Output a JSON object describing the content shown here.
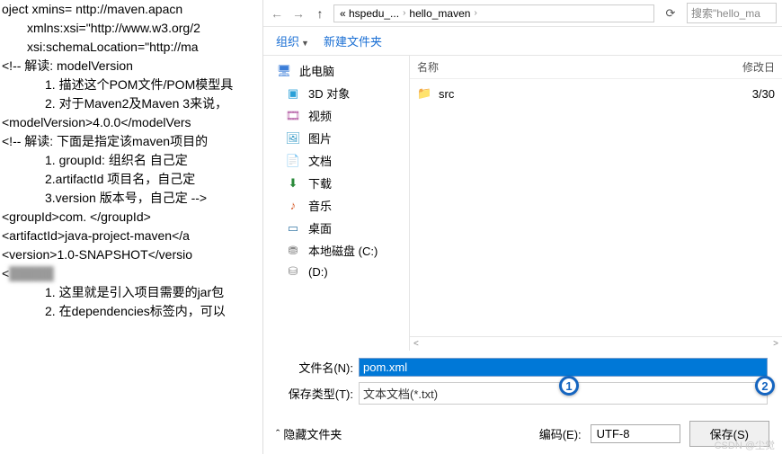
{
  "editor": {
    "lines": [
      "oject xmins= nttp://maven.apacn",
      "    xmlns:xsi=\"http://www.w3.org/2",
      "    xsi:schemaLocation=\"http://ma",
      "<!-- 解读: modelVersion",
      "        1. 描述这个POM文件/POM模型具",
      "        2. 对于Maven2及Maven 3来说，",
      "<modelVersion>4.0.0</modelVers",
      "",
      "<!-- 解读: 下面是指定该maven项目的",
      "        1. groupId: 组织名 自己定",
      "        2.artifactId 项目名，自己定",
      "        3.version 版本号，自己定   -->",
      "<groupId>com.           </groupId>",
      "<artifactId>java-project-maven</a",
      "<version>1.0-SNAPSHOT</versio",
      "",
      "<",
      "        1. 这里就是引入项目需要的jar包",
      "        2. 在dependencies标签内，可以"
    ]
  },
  "dialog": {
    "nav": {
      "back": "←",
      "fwd": "→",
      "up": "↑"
    },
    "breadcrumb": {
      "p1": "« hspedu_...",
      "p2": "hello_maven",
      "sep": "›"
    },
    "refresh_icon": "⟳",
    "search_placeholder": "搜索\"hello_ma",
    "toolbar": {
      "organize": "组织",
      "new_folder": "新建文件夹"
    },
    "sidebar": [
      {
        "icon": "🖥",
        "cls": "ico-pc",
        "label": "此电脑",
        "level": 0
      },
      {
        "icon": "▣",
        "cls": "ico-3d",
        "label": "3D 对象",
        "level": 1
      },
      {
        "icon": "🎞",
        "cls": "ico-vid",
        "label": "视频",
        "level": 1
      },
      {
        "icon": "🖼",
        "cls": "ico-pic",
        "label": "图片",
        "level": 1
      },
      {
        "icon": "📄",
        "cls": "ico-doc",
        "label": "文档",
        "level": 1
      },
      {
        "icon": "⬇",
        "cls": "ico-dl",
        "label": "下载",
        "level": 1
      },
      {
        "icon": "♪",
        "cls": "ico-mus",
        "label": "音乐",
        "level": 1
      },
      {
        "icon": "▭",
        "cls": "ico-desk",
        "label": "桌面",
        "level": 1
      },
      {
        "icon": "⛃",
        "cls": "ico-disk",
        "label": "本地磁盘 (C:)",
        "level": 1
      },
      {
        "icon": "⛁",
        "cls": "ico-disk",
        "label": "(D:)",
        "level": 1
      }
    ],
    "file_header": {
      "name": "名称",
      "date": "修改日"
    },
    "files": [
      {
        "icon": "📁",
        "name": "src",
        "date": "3/30"
      }
    ],
    "scroll": {
      "left": "<",
      "right": ">"
    },
    "form": {
      "filename_label": "文件名(N):",
      "filename_value": "pom.xml",
      "filetype_label": "保存类型(T):",
      "filetype_value": "文本文档(*.txt)"
    },
    "bottom": {
      "hide_folders": "隐藏文件夹",
      "encoding_label": "编码(E):",
      "encoding_value": "UTF-8",
      "save_label": "保存(S)"
    }
  },
  "markers": {
    "m1": "1",
    "m2": "2"
  },
  "watermark": "CSDN @尘觉"
}
